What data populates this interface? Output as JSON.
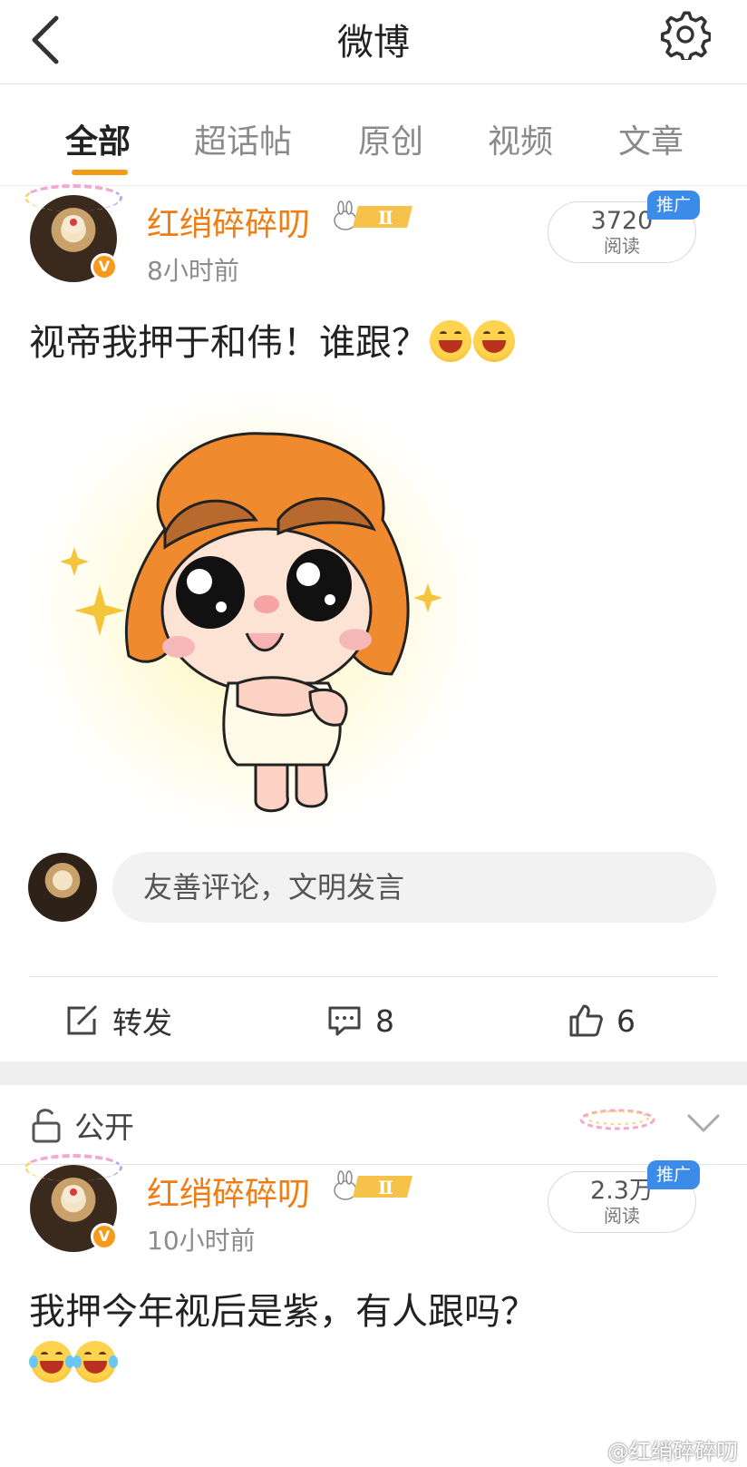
{
  "header": {
    "title": "微博",
    "back_icon": "chevron-left-icon",
    "settings_icon": "gear-icon"
  },
  "tabs": [
    {
      "label": "全部",
      "active": true
    },
    {
      "label": "超话帖",
      "active": false
    },
    {
      "label": "原创",
      "active": false
    },
    {
      "label": "视频",
      "active": false
    },
    {
      "label": "文章",
      "active": false
    }
  ],
  "posts": [
    {
      "username": "红绡碎碎叨",
      "level_badge": "Ⅱ",
      "verified_badge": "V",
      "time": "8小时前",
      "read_count": "3720",
      "read_label": "阅读",
      "promo_label": "推广",
      "text": "视帝我押于和伟！谁跟？",
      "emoji": "grinning-emoji",
      "comment_placeholder": "友善评论，文明发言",
      "actions": {
        "repost_label": "转发",
        "comment_count": "8",
        "like_count": "6"
      }
    },
    {
      "username": "红绡碎碎叨",
      "level_badge": "Ⅱ",
      "verified_badge": "V",
      "time": "10小时前",
      "read_count": "2.3万",
      "read_label": "阅读",
      "promo_label": "推广",
      "text": "我押今年视后是紫，有人跟吗？",
      "emoji": "tears-of-joy-emoji"
    }
  ],
  "visibility": {
    "label": "公开"
  },
  "watermark": "@红绡碎碎叨",
  "colors": {
    "accent": "#f39c11",
    "username": "#f07d14",
    "promo": "#3b8be8"
  }
}
